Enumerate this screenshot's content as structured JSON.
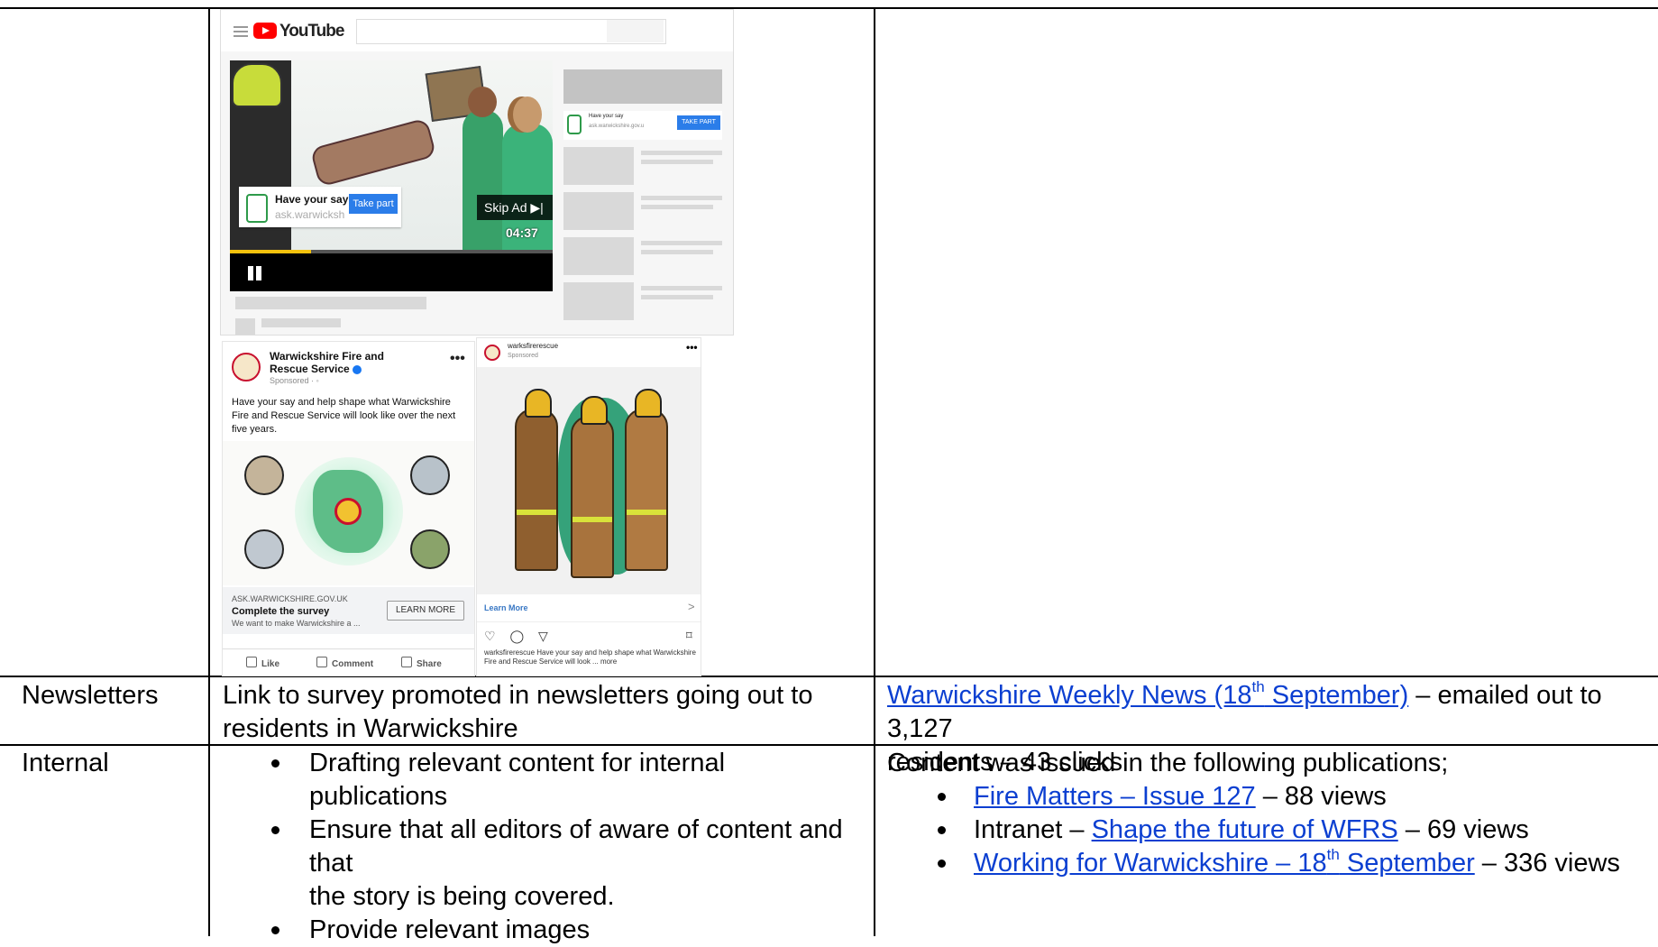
{
  "youtube": {
    "logo_text": "YouTube",
    "ad_title": "Have your say",
    "ad_url": "ask.warwicksh",
    "ad_button": "Take part",
    "skip_label": "Skip Ad ▶|",
    "time": "04:37",
    "progress": 0.25,
    "side_ad_title": "Have your say",
    "side_ad_url": "ask.warwickshire.gov.u",
    "side_ad_button": "TAKE PART"
  },
  "facebook": {
    "page_name": "Warwickshire Fire and Rescue Service",
    "sponsored": "Sponsored · ",
    "more": "•••",
    "body": "Have your say and help shape what Warwickshire Fire and Rescue Service will look like over the next five years.",
    "domain": "ASK.WARWICKSHIRE.GOV.UK",
    "cta_title": "Complete the survey",
    "cta_sub": "We want to make Warwickshire a ...",
    "learn_more": "LEARN MORE",
    "actions": [
      "Like",
      "Comment",
      "Share"
    ]
  },
  "instagram": {
    "username": "warksfirerescue",
    "sponsored": "Sponsored",
    "more": "•••",
    "learn_more": "Learn More",
    "chevron": ">",
    "action_icons": "♡ ◯ ▽",
    "save_icon": "⌑",
    "caption": "warksfirerescue Have your say and help shape what Warwickshire Fire and Rescue Service will look ... more"
  },
  "rows": {
    "newsletters": {
      "label": "Newsletters",
      "activity_line1": "Link to survey promoted in newsletters going out to",
      "activity_line2": "residents in Warwickshire",
      "result_link_a": "Warwickshire Weekly News (18",
      "result_link_sup": "th",
      "result_link_b": " September)",
      "result_tail": " – emailed out to 3,127",
      "result_line2": "residents – 43 clicks"
    },
    "internal": {
      "label": "Internal",
      "activity_bullets": [
        "Drafting relevant content for internal publications",
        "Ensure that all editors of aware of content and that",
        "the story is being covered.",
        "Provide relevant images"
      ],
      "result_intro": "Content was issued in the following publications;",
      "result_items": [
        {
          "prefix": "",
          "link": "Fire Matters – Issue 127",
          "suffix": " – 88 views"
        },
        {
          "prefix": "Intranet – ",
          "link": "Shape the future of WFRS",
          "suffix": " – 69 views"
        },
        {
          "prefix": "",
          "link_a": "Working for Warwickshire – 18",
          "link_sup": "th",
          "link_b": " September",
          "suffix": " – 336 views"
        }
      ]
    }
  }
}
